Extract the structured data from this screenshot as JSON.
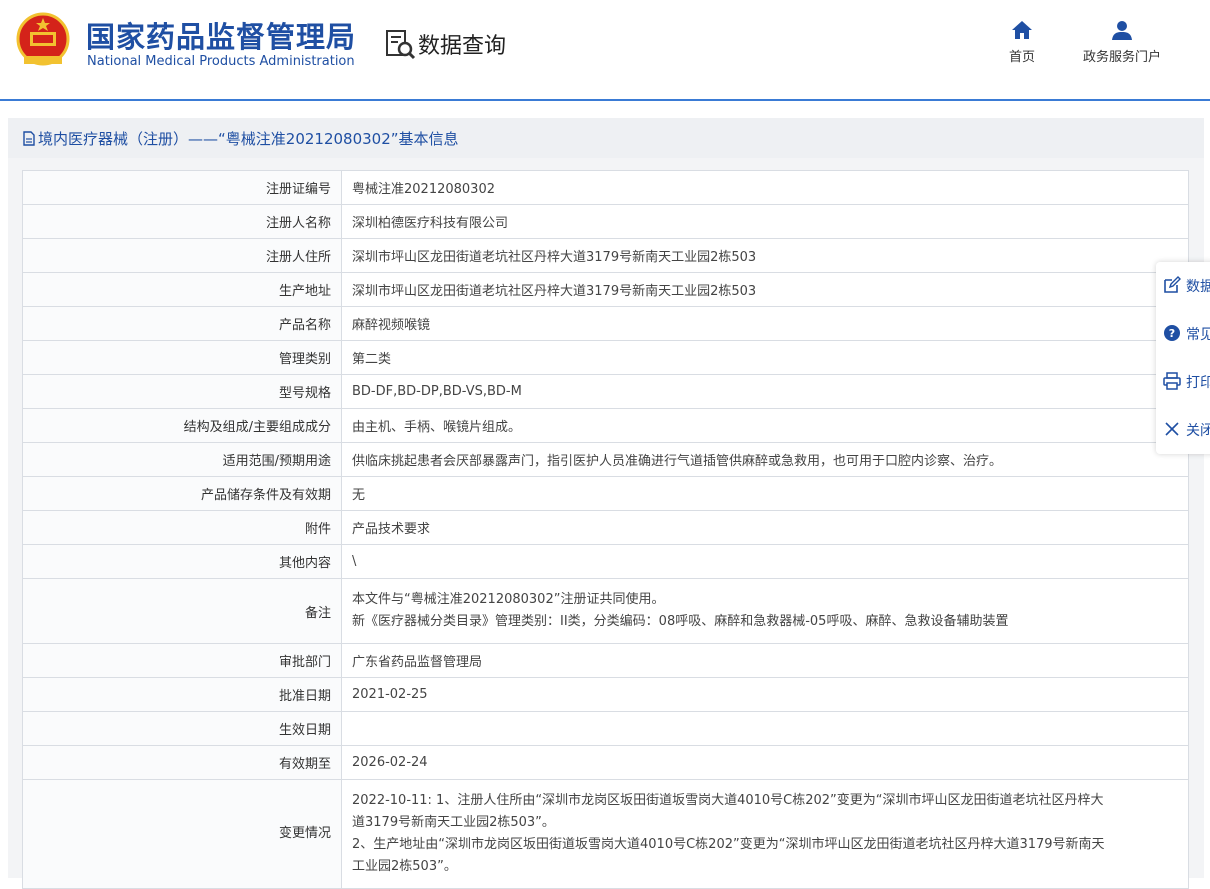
{
  "header": {
    "org_name_cn": "国家药品监督管理局",
    "org_name_en": "National Medical Products Administration",
    "section_title": "数据查询",
    "nav": {
      "home_label": "首页",
      "portal_label": "政务服务门户"
    }
  },
  "panel": {
    "title": "境内医疗器械（注册）——“粤械注准20212080302”基本信息"
  },
  "rows": [
    {
      "label": "注册证编号",
      "value": "粤械注准20212080302"
    },
    {
      "label": "注册人名称",
      "value": "深圳柏德医疗科技有限公司"
    },
    {
      "label": "注册人住所",
      "value": "深圳市坪山区龙田街道老坑社区丹梓大道3179号新南天工业园2栋503"
    },
    {
      "label": "生产地址",
      "value": "深圳市坪山区龙田街道老坑社区丹梓大道3179号新南天工业园2栋503"
    },
    {
      "label": "产品名称",
      "value": "麻醉视频喉镜"
    },
    {
      "label": "管理类别",
      "value": "第二类"
    },
    {
      "label": "型号规格",
      "value": "BD-DF,BD-DP,BD-VS,BD-M"
    },
    {
      "label": "结构及组成/主要组成成分",
      "value": "由主机、手柄、喉镜片组成。"
    },
    {
      "label": "适用范围/预期用途",
      "value": "供临床挑起患者会厌部暴露声门，指引医护人员准确进行气道插管供麻醉或急救用，也可用于口腔内诊察、治疗。"
    },
    {
      "label": "产品储存条件及有效期",
      "value": "无"
    },
    {
      "label": "附件",
      "value": "产品技术要求"
    },
    {
      "label": "其他内容",
      "value": "\\"
    },
    {
      "label": "备注",
      "value_line1": "本文件与“粤械注准20212080302”注册证共同使用。",
      "value_line2": "新《医疗器械分类目录》管理类别：II类，分类编码：08呼吸、麻醉和急救器械-05呼吸、麻醉、急救设备辅助装置"
    },
    {
      "label": "审批部门",
      "value": "广东省药品监督管理局"
    },
    {
      "label": "批准日期",
      "value": "2021-02-25"
    },
    {
      "label": "生效日期",
      "value": ""
    },
    {
      "label": "有效期至",
      "value": "2026-02-24"
    },
    {
      "label": "变更情况",
      "value_line1": "2022-10-11: 1、注册人住所由“深圳市龙岗区坂田街道坂雪岗大道4010号C栋202”变更为“深圳市坪山区龙田街道老坑社区丹梓大",
      "value_line2": "道3179号新南天工业园2栋503”。",
      "value_line3": "2、生产地址由“深圳市龙岗区坂田街道坂雪岗大道4010号C栋202”变更为“深圳市坪山区龙田街道老坑社区丹梓大道3179号新南天",
      "value_line4": "工业园2栋503”。"
    }
  ],
  "sidebar": {
    "items": [
      {
        "label": "数据",
        "icon": "edit-icon"
      },
      {
        "label": "常见",
        "icon": "question-icon"
      },
      {
        "label": "打印",
        "icon": "print-icon"
      },
      {
        "label": "关闭",
        "icon": "close-icon"
      }
    ]
  },
  "colors": {
    "brand_blue": "#1f4fa3",
    "header_rule": "#3a7bd5",
    "emblem_red": "#d4231a",
    "emblem_gold": "#f2c230"
  }
}
